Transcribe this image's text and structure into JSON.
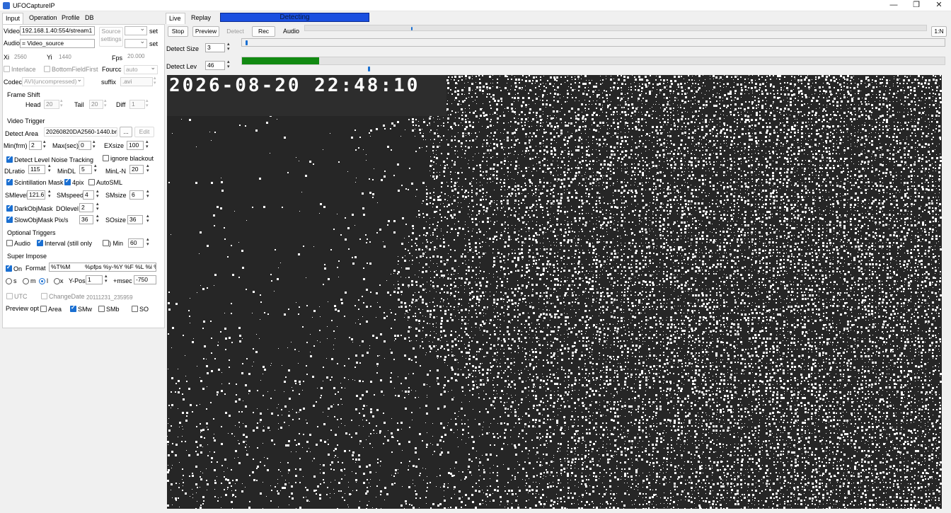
{
  "window": {
    "title": "UFOCaptureIP",
    "controls": [
      "—",
      "❐",
      "✕"
    ]
  },
  "left_tabs": [
    "Input",
    "Operation",
    "Profile",
    "DB"
  ],
  "input": {
    "video_label": "Video",
    "video_value": "192.168.1.40:554/stream1",
    "audio_label": "Audio",
    "audio_value": "= Video_source",
    "source_settings": "Source\nsettings",
    "set_label": "set",
    "xi_label": "Xi",
    "xi_value": "2560",
    "yi_label": "Yi",
    "yi_value": "1440",
    "fps_label": "Fps",
    "fps_value": "20.000",
    "interlace_label": "Interlace",
    "bottom_field_label": "BottomFieldFirst",
    "fourcc_label": "Fourcc",
    "fourcc_value": "auto",
    "codec_label": "Codec",
    "codec_value": "AVI(uncompressed)",
    "suffix_label": "suffix",
    "suffix_value": ".avi"
  },
  "frame_shift": {
    "title": "Frame Shift",
    "head_label": "Head",
    "head_value": "20",
    "tail_label": "Tail",
    "tail_value": "20",
    "diff_label": "Diff",
    "diff_value": "1"
  },
  "video_trigger": {
    "title": "Video Trigger",
    "detect_area_label": "Detect Area",
    "detect_area_value": "20260820DA2560-1440.bmp",
    "browse_label": "...",
    "edit_label": "Edit",
    "minfrm_label": "Min(frm)",
    "minfrm_value": "2",
    "maxsec_label": "Max(sec)",
    "maxsec_value": "0",
    "exsize_label": "EXsize",
    "exsize_value": "100",
    "dlnt_label": "Detect Level Noise Tracking",
    "ignore_blackout_label": "ignore blackout",
    "dlratio_label": "DLratio",
    "dlratio_value": "115",
    "mindl_label": "MinDL",
    "mindl_value": "5",
    "minln_label": "MinL-N",
    "minln_value": "20",
    "scint_label": "Scintillation Mask",
    "fourpix_label": "4pix",
    "autosml_label": "AutoSML",
    "smlevel_label": "SMlevel",
    "smlevel_value": "121.6",
    "smspeed_label": "SMspeed",
    "smspeed_value": "4",
    "smsize_label": "SMsize",
    "smsize_value": "6",
    "darkobj_label": "DarkObjMask",
    "dolevel_label": "DOlevel",
    "dolevel_value": "2",
    "slowobj_label": "SlowObjMask",
    "pixs_label": "Pix/s",
    "pixs_value": "36",
    "sosize_label": "SOsize",
    "sosize_value": "36"
  },
  "optional_triggers": {
    "title": "Optional Triggers",
    "audio_label": "Audio",
    "interval_label": "Interval (still only",
    "min_label": ") Min",
    "min_value": "60"
  },
  "super_impose": {
    "title": "Super Impose",
    "on_label": "On",
    "format_label": "Format",
    "format_value": "%T%M",
    "format_value2": "%pfps %y-%Y %F %L  %i %",
    "r_s": "s",
    "r_m": "m",
    "r_l": "l",
    "r_x": "x",
    "ypos_label": "Y-Pos",
    "ypos_value": "1",
    "msec_label": "+msec",
    "msec_value": "-750",
    "utc_label": "UTC",
    "changedate_label": "ChangeDate",
    "changedate_value": "20111231_235959",
    "preview_opt_label": "Preview opt",
    "area_label": "Area",
    "smw_label": "SMw",
    "smb_label": "SMb",
    "so_label": "SO"
  },
  "right_tabs": [
    "Live",
    "Replay"
  ],
  "status": "Detecting",
  "toolbar": {
    "stop": "Stop",
    "preview": "Preview",
    "detect": "Detect",
    "rec": "Rec",
    "audio": "Audio",
    "one_n": "1:N"
  },
  "detect_size": {
    "label": "Detect Size",
    "value": "3",
    "level": 0.003
  },
  "detect_lev": {
    "label": "Detect Lev",
    "value": "46",
    "bar_fill": 0.11,
    "level": 0.18
  },
  "audio_level": 0.17,
  "video": {
    "timestamp": "2026-08-20  22:48:10"
  },
  "colors": {
    "status_bg": "#1a4fe0",
    "detect_bar": "#128a12",
    "check": "#1a6fd1"
  }
}
